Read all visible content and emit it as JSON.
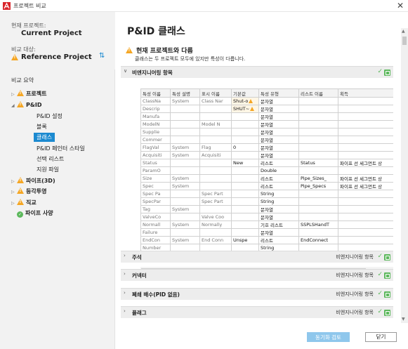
{
  "window": {
    "title": "프로젝트 비교"
  },
  "sidebar": {
    "current_label": "현재 프로젝트:",
    "current_name": "Current Project",
    "compare_label": "비교 대상:",
    "compare_name": "Reference Project",
    "summary_title": "비교 요약",
    "tree": [
      {
        "label": "프로젝트",
        "status": "warning",
        "level": 0,
        "expander": "right"
      },
      {
        "label": "P&ID",
        "status": "warning",
        "level": 0,
        "expander": "down"
      },
      {
        "label": "P&ID 설정",
        "level": 1
      },
      {
        "label": "블록",
        "level": 1
      },
      {
        "label": "클래스",
        "level": 1,
        "selected": true
      },
      {
        "label": "P&ID 페인터 스타일",
        "level": 1
      },
      {
        "label": "선택 리스트",
        "level": 1
      },
      {
        "label": "지원 파일",
        "level": 1
      },
      {
        "label": "파이프(3D)",
        "status": "warning",
        "level": 0,
        "expander": "right"
      },
      {
        "label": "등각투영",
        "status": "warning",
        "level": 0,
        "expander": "right"
      },
      {
        "label": "직교",
        "status": "warning",
        "level": 0,
        "expander": "right"
      },
      {
        "label": "파이프 사양",
        "status": "ok",
        "level": 0
      }
    ]
  },
  "main": {
    "title": "P&ID 클래스",
    "warning_title": "현재 프로젝트와 다름",
    "warning_sub": "클래스는 두 프로젝트 모두에 있지만 특성이 다릅니다.",
    "sections": [
      {
        "label": "비엔지니어링 항목",
        "category": "",
        "expanded": true
      },
      {
        "label": "주석",
        "category": "비엔지니어링 항목"
      },
      {
        "label": "커넥터",
        "category": "비엔지니어링 항목"
      },
      {
        "label": "폐쇄 배수(PID 없음)",
        "category": "비엔지니어링 항목"
      },
      {
        "label": "플래그",
        "category": "비엔지니어링 항목"
      }
    ],
    "grid": {
      "headers": [
        "특성 이름",
        "특성 설명",
        "표시 이름",
        "기본값",
        "특성 유형",
        "리스트 이름",
        "획득"
      ],
      "rows": [
        [
          "ClassNa",
          "System",
          "Class Nar",
          "Shut-o",
          "문자열",
          "",
          ""
        ],
        [
          "Descrip",
          "",
          "",
          "SHUT~",
          "문자열",
          "",
          ""
        ],
        [
          "Manufa",
          "",
          "",
          "",
          "문자열",
          "",
          ""
        ],
        [
          "ModelN",
          "",
          "Model N",
          "",
          "문자열",
          "",
          ""
        ],
        [
          "Supplie",
          "",
          "",
          "",
          "문자열",
          "",
          ""
        ],
        [
          "Commer",
          "",
          "",
          "",
          "문자열",
          "",
          ""
        ],
        [
          "FlagVal",
          "System",
          "Flag",
          "0",
          "문자열",
          "",
          ""
        ],
        [
          "Acquisiti",
          "System",
          "Acquisiti",
          "",
          "문자열",
          "",
          ""
        ],
        [
          "Status",
          "",
          "",
          "New",
          "리스트",
          "Status",
          "파이프 선 세그먼트 상"
        ],
        [
          "ParamO",
          "",
          "",
          "",
          "Double",
          "",
          ""
        ],
        [
          "Size",
          "System",
          "",
          "",
          "리스트",
          "Pipe_Sizes_",
          "파이프 선 세그먼트 상"
        ],
        [
          "Spec",
          "System",
          "",
          "",
          "리스트",
          "Pipe_Specs",
          "파이프 선 세그먼트 상"
        ],
        [
          "Spec Pa",
          "",
          "Spec Part",
          "",
          "String",
          "",
          ""
        ],
        [
          "SpecPar",
          "",
          "Spec Part",
          "",
          "String",
          "",
          ""
        ],
        [
          "Tag",
          "System",
          "",
          "",
          "문자열",
          "",
          ""
        ],
        [
          "ValveCo",
          "",
          "Valve Coo",
          "",
          "문자열",
          "",
          ""
        ],
        [
          "Normall",
          "System",
          "Normally",
          "",
          "기호 리스트",
          "SSPLSHandT",
          ""
        ],
        [
          "Failure",
          "",
          "",
          "",
          "문자열",
          "",
          ""
        ],
        [
          "EndCon",
          "System",
          "End Conn",
          "Unspe",
          "리스트",
          "EndConnect",
          ""
        ],
        [
          "Number",
          "",
          "",
          "",
          "String",
          "",
          ""
        ]
      ]
    }
  },
  "footer": {
    "sync_label": "동기화 검토",
    "close_label": "닫기"
  },
  "colors": {
    "accent": "#1c8ad0",
    "warning": "#f5a623",
    "ok": "#5cb85c"
  }
}
